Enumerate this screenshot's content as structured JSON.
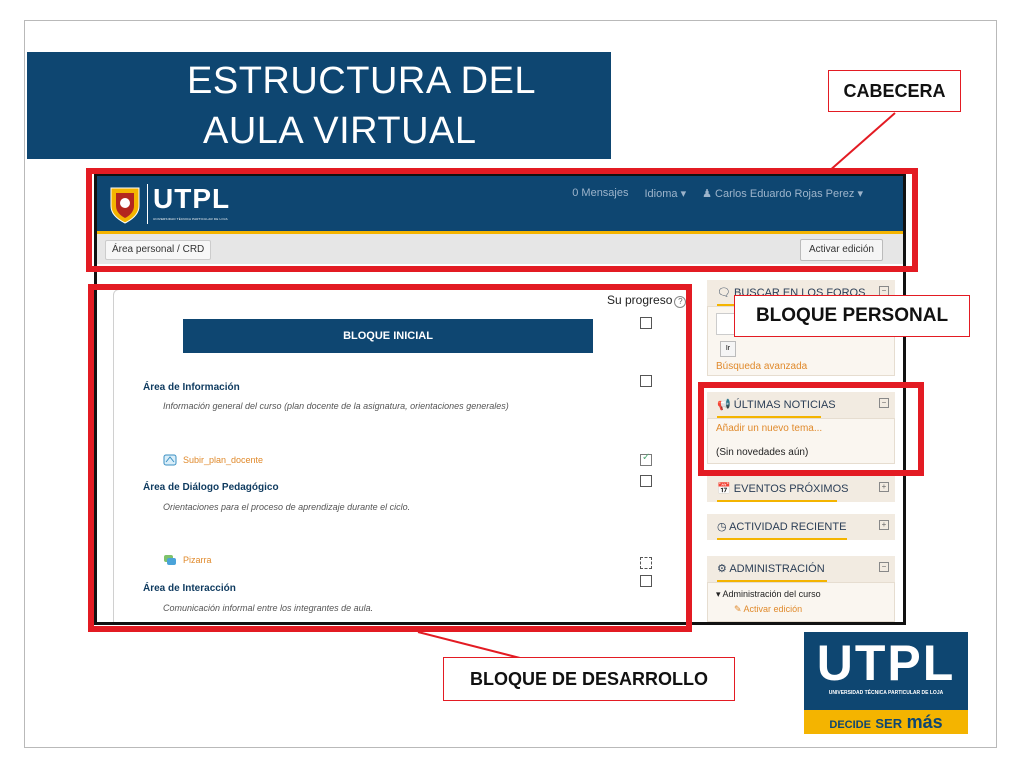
{
  "slide": {
    "title_line1": "ESTRUCTURA DEL",
    "title_line2": "AULA VIRTUAL",
    "callouts": {
      "cabecera": "CABECERA",
      "bloque_personal": "BLOQUE PERSONAL",
      "bloque_desarrollo": "BLOQUE DE DESARROLLO"
    },
    "colors": {
      "brand_blue": "#0e4671",
      "callout_red": "#e31b23",
      "accent_yellow": "#f4b400"
    },
    "corner_logo": {
      "text": "UTPL",
      "subtitle": "UNIVERSIDAD TÉCNICA PARTICULAR DE LOJA",
      "slogan_a": "DECIDE",
      "slogan_b": "SER",
      "slogan_c": "más"
    }
  },
  "moodle": {
    "header": {
      "logo_text": "UTPL",
      "logo_sub": "UNIVERSIDAD TÉCNICA PARTICULAR DE LOJA",
      "messages": "0 Mensajes",
      "language": "Idioma ▾",
      "user": "♟ Carlos Eduardo Rojas Perez ▾"
    },
    "breadcrumb": "Área personal / CRD",
    "edit_button": "Activar edición",
    "course": {
      "progress_label": "Su progreso",
      "banner": "BLOQUE INICIAL",
      "sections": [
        {
          "title": "Área  de Información",
          "desc": "Información general del curso (plan docente de la asignatura, orientaciones generales)",
          "activity": "Subir_plan_docente"
        },
        {
          "title": "Área  de Diálogo Pedagógico",
          "desc": "Orientaciones para el proceso de aprendizaje durante el ciclo.",
          "activity": "Pizarra"
        },
        {
          "title": "Área  de Interacción",
          "desc": "Comunicación informal entre los integrantes de aula."
        }
      ]
    },
    "sidebar": {
      "search": {
        "title": "BUSCAR EN LOS FOROS",
        "go": "Ir",
        "advanced": "Búsqueda avanzada"
      },
      "news": {
        "title": "ÚLTIMAS NOTICIAS",
        "add": "Añadir un nuevo tema...",
        "empty": "(Sin novedades aún)"
      },
      "events": {
        "title": "EVENTOS PRÓXIMOS"
      },
      "recent": {
        "title": "ACTIVIDAD RECIENTE"
      },
      "admin": {
        "title": "ADMINISTRACIÓN",
        "course_admin": "Administración del curso",
        "enable_edit": "Activar edición"
      }
    }
  }
}
